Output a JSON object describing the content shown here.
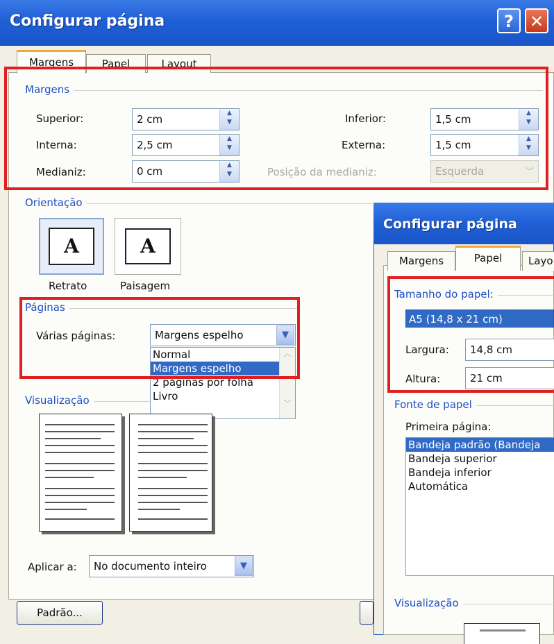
{
  "main_dialog": {
    "title": "Configurar página",
    "help_label": "?",
    "close_label": "✕",
    "tabs": [
      {
        "label": "Margens",
        "active": true
      },
      {
        "label": "Papel",
        "active": false
      },
      {
        "label": "Layout",
        "active": false
      }
    ],
    "margins": {
      "group_title": "Margens",
      "superior": {
        "label": "Superior:",
        "value": "2 cm"
      },
      "inferior": {
        "label": "Inferior:",
        "value": "1,5 cm"
      },
      "interna": {
        "label": "Interna:",
        "value": "2,5 cm"
      },
      "externa": {
        "label": "Externa:",
        "value": "1,5 cm"
      },
      "medianiz": {
        "label": "Medianiz:",
        "value": "0 cm"
      },
      "posicao_medianiz": {
        "label": "Posição da medianiz:",
        "value": "Esquerda"
      }
    },
    "orientation": {
      "group_title": "Orientação",
      "portrait_label": "Retrato",
      "landscape_label": "Paisagem",
      "icon_letter": "A"
    },
    "pages": {
      "group_title": "Páginas",
      "multiple_pages_label": "Várias páginas:",
      "selected": "Margens espelho",
      "options": [
        "Normal",
        "Margens espelho",
        "2 páginas por folha",
        "Livro"
      ]
    },
    "preview": {
      "group_title": "Visualização"
    },
    "apply_to": {
      "label": "Aplicar a:",
      "value": "No documento inteiro"
    },
    "default_button": "Padrão..."
  },
  "paper_dialog": {
    "title": "Configurar página",
    "tabs": [
      {
        "label": "Margens",
        "active": false
      },
      {
        "label": "Papel",
        "active": true
      },
      {
        "label": "Layo",
        "active": false
      }
    ],
    "paper_size": {
      "group_title": "Tamanho do papel:",
      "selected": "A5 (14,8 x 21 cm)",
      "width": {
        "label": "Largura:",
        "value": "14,8 cm"
      },
      "height": {
        "label": "Altura:",
        "value": "21 cm"
      }
    },
    "paper_source": {
      "group_title": "Fonte de papel",
      "first_page_label": "Primeira página:",
      "options": [
        "Bandeja padrão (Bandeja",
        "Bandeja superior",
        "Bandeja inferior",
        "Automática"
      ]
    },
    "preview": {
      "group_title": "Visualização"
    }
  },
  "colors": {
    "title_blue": "#1f5fd6",
    "highlight_red": "#e02020",
    "group_title_blue": "#1f4fc6",
    "selection_blue": "#316ac5"
  }
}
